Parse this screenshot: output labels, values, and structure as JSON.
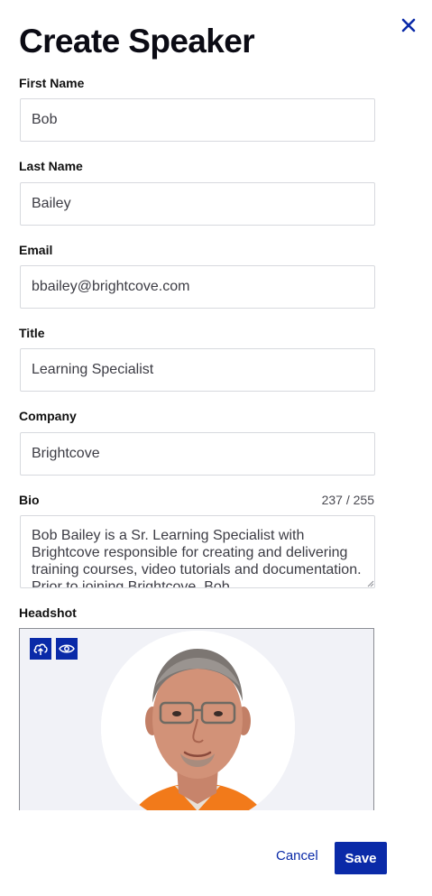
{
  "header": {
    "title": "Create Speaker",
    "close_icon": "close-icon"
  },
  "fields": {
    "first_name": {
      "label": "First Name",
      "value": "Bob"
    },
    "last_name": {
      "label": "Last Name",
      "value": "Bailey"
    },
    "email": {
      "label": "Email",
      "value": "bbailey@brightcove.com"
    },
    "title": {
      "label": "Title",
      "value": "Learning Specialist"
    },
    "company": {
      "label": "Company",
      "value": "Brightcove"
    },
    "bio": {
      "label": "Bio",
      "char_count": "237 / 255",
      "value": "Bob Bailey is a Sr. Learning Specialist with Brightcove responsible for creating and delivering training courses, video tutorials and documentation. Prior to joining Brightcove, Bob"
    }
  },
  "headshot": {
    "label": "Headshot",
    "upload_icon": "upload-cloud-icon",
    "preview_icon": "eye-icon"
  },
  "footer": {
    "cancel_label": "Cancel",
    "save_label": "Save"
  },
  "colors": {
    "accent": "#0a2aa8",
    "border": "#d7d9de",
    "headshot_bg": "#f1f2f7"
  }
}
